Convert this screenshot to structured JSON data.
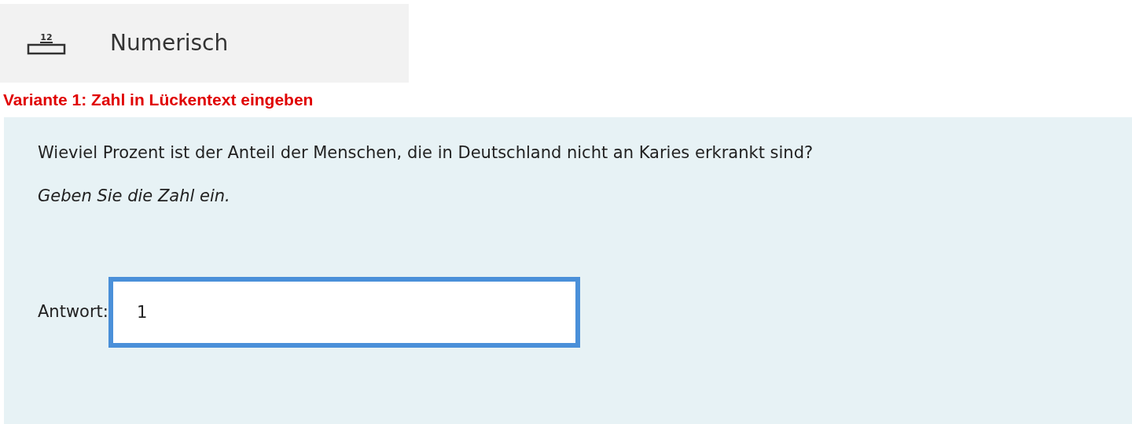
{
  "question_type": {
    "label": "Numerisch",
    "icon_label": "12"
  },
  "heading": "Variante 1: Zahl in Lückentext eingeben",
  "question": {
    "text": "Wieviel Prozent ist der Anteil der Menschen, die in Deutschland nicht an Karies erkrankt sind?",
    "instruction": "Geben Sie die Zahl ein.",
    "answer_label": "Antwort:",
    "answer_value": "1"
  }
}
